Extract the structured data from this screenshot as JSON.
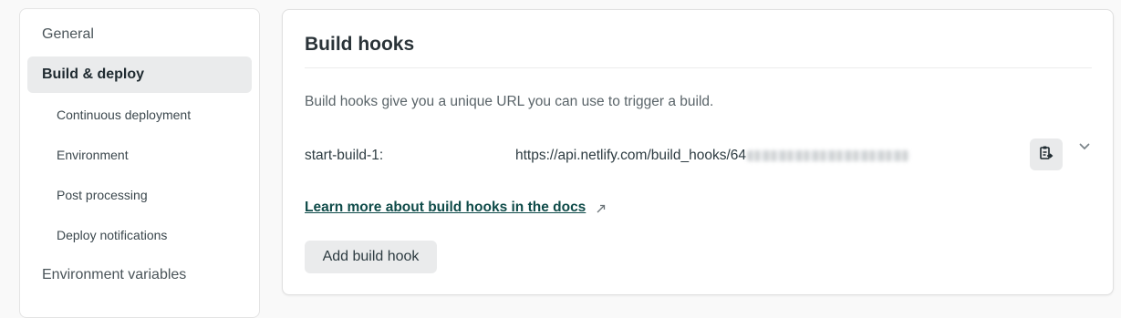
{
  "sidebar": {
    "items": [
      {
        "label": "General"
      },
      {
        "label": "Build & deploy"
      },
      {
        "label": "Continuous deployment"
      },
      {
        "label": "Environment"
      },
      {
        "label": "Post processing"
      },
      {
        "label": "Deploy notifications"
      },
      {
        "label": "Environment variables"
      }
    ],
    "active_index": 1
  },
  "build_hooks": {
    "title": "Build hooks",
    "description": "Build hooks give you a unique URL you can use to trigger a build.",
    "hooks": [
      {
        "name": "start-build-1:",
        "url_visible": "https://api.netlify.com/build_hooks/64"
      }
    ],
    "learn_more": "Learn more about build hooks in the docs",
    "add_button": "Add build hook"
  },
  "icons": {
    "copy": "clipboard-copy-icon",
    "expand": "chevron-down-icon",
    "external": "external-link-arrow-icon"
  },
  "colors": {
    "link": "#0f4b49",
    "active_bg": "#eaebec",
    "page_bg": "#f9f9f9"
  }
}
